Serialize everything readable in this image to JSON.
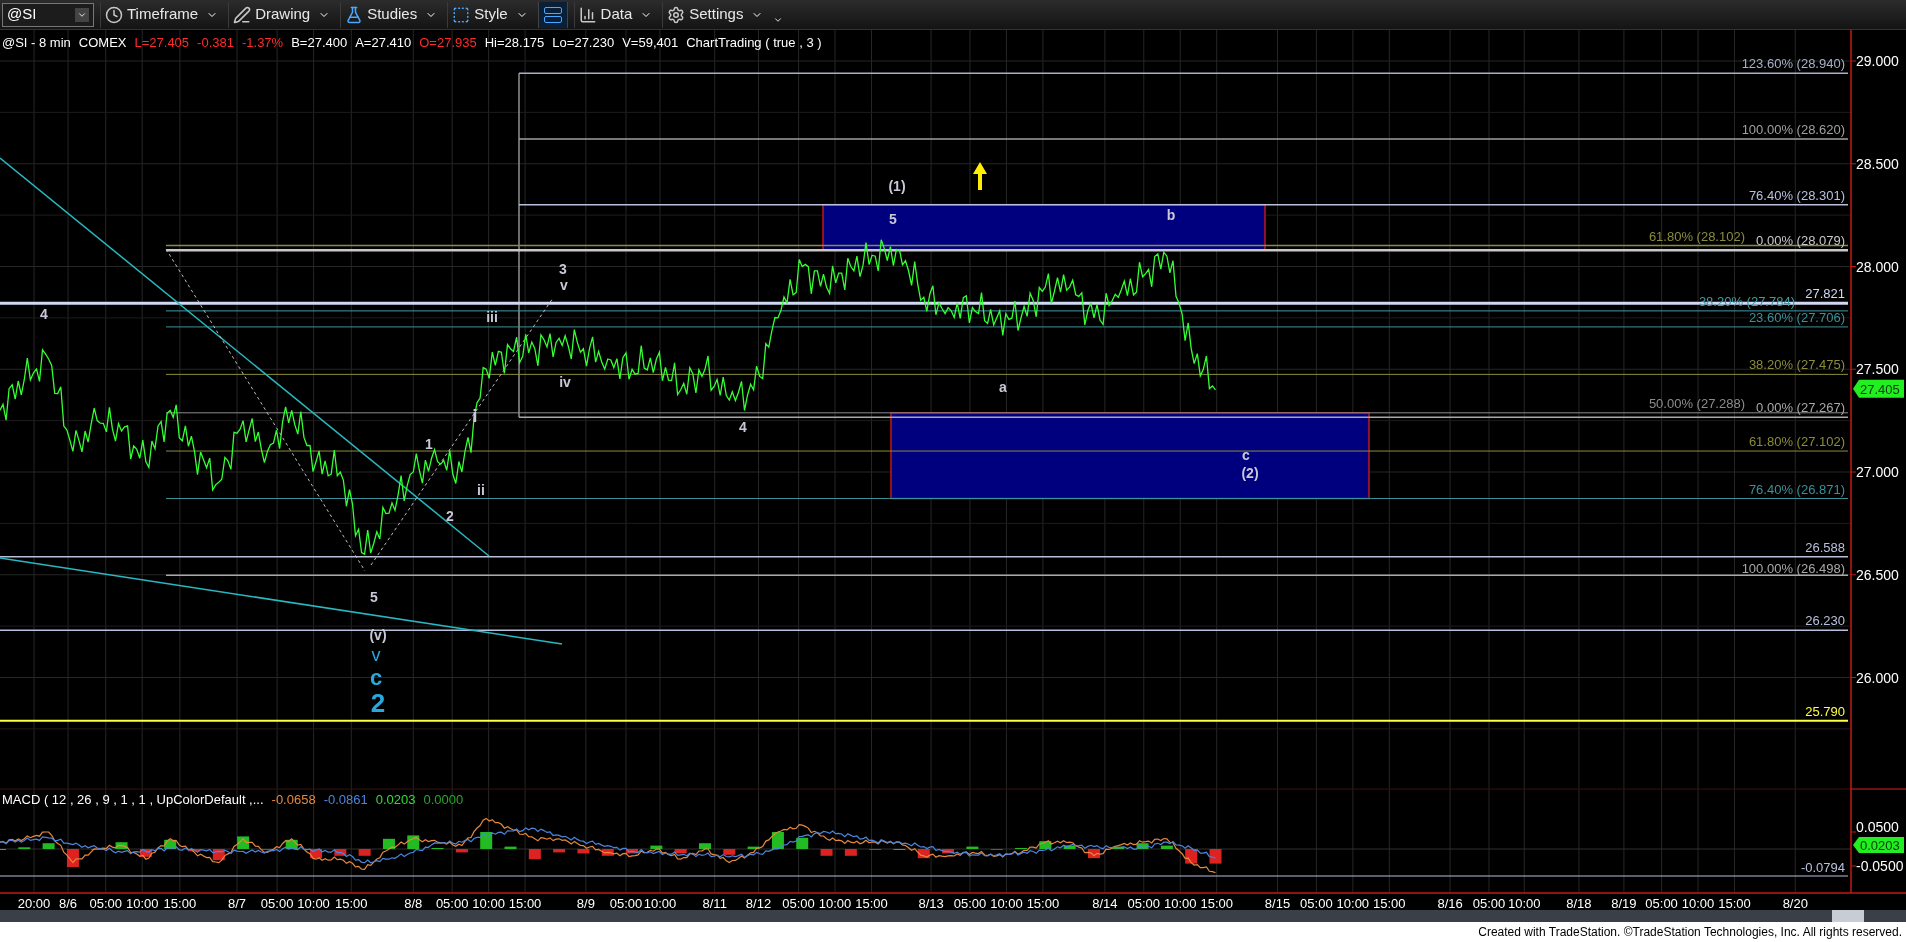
{
  "toolbar": {
    "symbol": "@SI",
    "buttons": [
      {
        "label": "Timeframe",
        "kind": "clock"
      },
      {
        "label": "Drawing",
        "kind": "pen"
      },
      {
        "label": "Studies",
        "kind": "flask"
      },
      {
        "label": "Style",
        "kind": "style"
      },
      {
        "kind": "layout",
        "selected": true
      },
      {
        "label": "Data",
        "kind": "bars"
      },
      {
        "label": "Settings",
        "kind": "gear"
      },
      {
        "kind": "more"
      }
    ]
  },
  "info_line": [
    {
      "text": "@SI - 8 min",
      "color": "#ffffff"
    },
    {
      "text": "COMEX",
      "color": "#ffffff"
    },
    {
      "text": "L=27.405",
      "color": "#ff2a2a"
    },
    {
      "text": "-0.381",
      "color": "#ff2a2a"
    },
    {
      "text": "-1.37%",
      "color": "#ff2a2a"
    },
    {
      "text": "B=27.400",
      "color": "#ffffff"
    },
    {
      "text": "A=27.410",
      "color": "#ffffff"
    },
    {
      "text": "O=27.935",
      "color": "#ff2a2a"
    },
    {
      "text": "Hi=28.175",
      "color": "#ffffff"
    },
    {
      "text": "Lo=27.230",
      "color": "#ffffff"
    },
    {
      "text": "V=59,401",
      "color": "#ffffff"
    },
    {
      "text": "ChartTrading ( true , 3 )",
      "color": "#ffffff"
    }
  ],
  "price_chart": {
    "price_axis": [
      "29.000",
      "28.500",
      "28.000",
      "27.500",
      "27.000",
      "26.500",
      "26.000"
    ],
    "levels": [
      {
        "label": "123.60% (28.940)",
        "color": "#a8b0c8"
      },
      {
        "label": "100.00% (28.620)",
        "color": "#a0a0a0"
      },
      {
        "label": "76.40% (28.301)",
        "color": "#b8c0dc"
      },
      {
        "label": "61.80% (28.102)",
        "color": "#8c8c3c"
      },
      {
        "label": "0.00% (28.079)",
        "color": "#c8c8c8"
      },
      {
        "label": "27.821",
        "color": "#d0d8f4"
      },
      {
        "label": "38.20% (27.784)",
        "color": "#3c9ca4"
      },
      {
        "label": "23.60% (27.706)",
        "color": "#3c9098"
      },
      {
        "label": "38.20% (27.475)",
        "color": "#8c8c3c"
      },
      {
        "label": "50.00% (27.288)",
        "color": "#8c8c8c"
      },
      {
        "label": "0.00% (27.267)",
        "color": "#a8a8a8"
      },
      {
        "label": "61.80% (27.102)",
        "color": "#8c8c3c"
      },
      {
        "label": "76.40% (26.871)",
        "color": "#3c9098"
      },
      {
        "label": "26.588",
        "color": "#b8c0dc"
      },
      {
        "label": "100.00% (26.498)",
        "color": "#a8a8a8"
      },
      {
        "label": "26.230",
        "color": "#b8c0dc"
      },
      {
        "label": "25.790",
        "color": "#ffff44"
      }
    ],
    "current_price": "27.405",
    "wave_labels": [
      {
        "text": "4",
        "color": "#c8c8d8"
      },
      {
        "text": "iii",
        "color": "#c8c8d8"
      },
      {
        "text": "3",
        "color": "#c8c8d8"
      },
      {
        "text": "v",
        "color": "#c8c8d8"
      },
      {
        "text": "iv",
        "color": "#c8c8d8"
      },
      {
        "text": "1",
        "color": "#c8c8d8"
      },
      {
        "text": "i",
        "color": "#c8c8d8"
      },
      {
        "text": "2",
        "color": "#c8c8d8"
      },
      {
        "text": "ii",
        "color": "#c8c8d8"
      },
      {
        "text": "4",
        "color": "#c8c8d8"
      },
      {
        "text": "(1)",
        "color": "#c8c8d8"
      },
      {
        "text": "5",
        "color": "#c8c8d8"
      },
      {
        "text": "b",
        "color": "#c8c8d8"
      },
      {
        "text": "a",
        "color": "#c8c8d8"
      },
      {
        "text": "c",
        "color": "#c8c8d8"
      },
      {
        "text": "(2)",
        "color": "#c8c8d8"
      },
      {
        "text": "5",
        "color": "#c8c8d8"
      },
      {
        "text": "(v)",
        "color": "#c8c8d8"
      },
      {
        "text": "v",
        "color": "#2aa8dc"
      },
      {
        "text": "c",
        "color": "#2aa8dc"
      },
      {
        "text": "2",
        "color": "#2aa8dc"
      }
    ]
  },
  "macd": {
    "title": "MACD ( 12 , 26 , 9 , 1 , 1 , UpColorDefault ,...",
    "readings": [
      {
        "text": "-0.0658",
        "color": "#e8883c"
      },
      {
        "text": "-0.0861",
        "color": "#4a86e0"
      },
      {
        "text": "0.0203",
        "color": "#33dd33"
      },
      {
        "text": "0.0000",
        "color": "#22aa22"
      }
    ],
    "value_axis": [
      "0.0500",
      "-0.0500"
    ],
    "level_label": "-0.0794",
    "current_value": "0.0203"
  },
  "time_labels": [
    "20:00",
    "8/6",
    "05:00",
    "10:00",
    "15:00",
    "8/7",
    "05:00",
    "10:00",
    "15:00",
    "8/8",
    "05:00",
    "10:00",
    "15:00",
    "8/9",
    "05:00",
    "10:00",
    "8/11",
    "8/12",
    "05:00",
    "10:00",
    "15:00",
    "8/13",
    "05:00",
    "10:00",
    "15:00",
    "8/14",
    "05:00",
    "10:00",
    "15:00",
    "8/15",
    "05:00",
    "10:00",
    "15:00",
    "8/16",
    "05:00",
    "10:00",
    "8/18",
    "8/19",
    "05:00",
    "10:00",
    "15:00",
    "8/20"
  ],
  "footer": "Created with TradeStation. ©TradeStation Technologies, Inc. All rights reserved."
}
